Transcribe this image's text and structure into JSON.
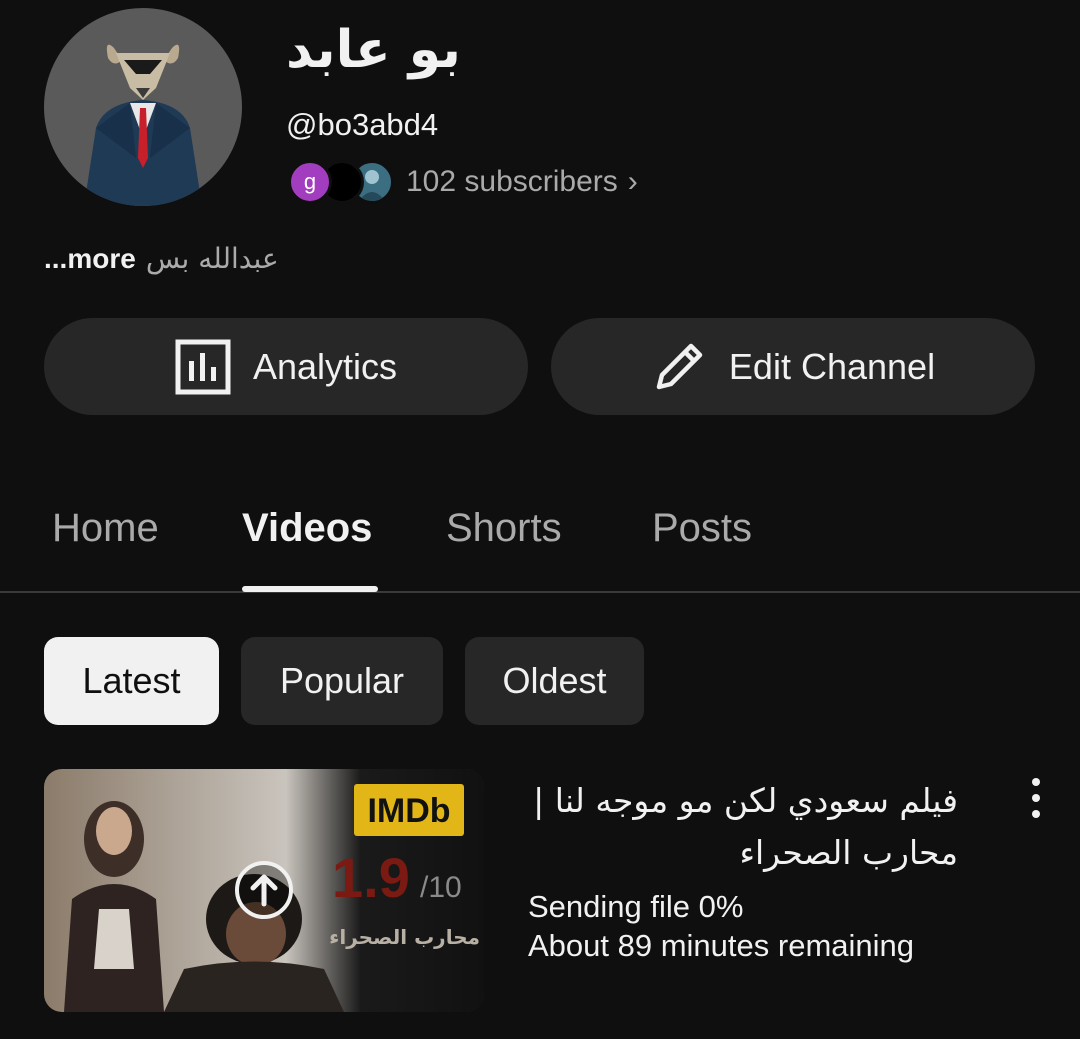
{
  "channel": {
    "name": "بو عابد",
    "handle": "@bo3abd4",
    "subscribers_text": "102 subscribers",
    "subscriber_avatar_initial": "g",
    "description": "عبدالله بس",
    "more_label": "...more"
  },
  "actions": {
    "analytics_label": "Analytics",
    "edit_label": "Edit Channel"
  },
  "tabs": [
    {
      "label": "Home",
      "active": false
    },
    {
      "label": "Videos",
      "active": true
    },
    {
      "label": "Shorts",
      "active": false
    },
    {
      "label": "Posts",
      "active": false
    }
  ],
  "sort_chips": [
    {
      "label": "Latest",
      "selected": true
    },
    {
      "label": "Popular",
      "selected": false
    },
    {
      "label": "Oldest",
      "selected": false
    }
  ],
  "video": {
    "title_line1": "فيلم سعودي لكن مو موجه لنا |",
    "title_line2": "محارب الصحراء",
    "status_line1": "Sending file 0%",
    "status_line2": "About 89 minutes remaining",
    "upload_progress_percent": 0,
    "thumb_badge": "IMDb",
    "thumb_rating": "1.9",
    "thumb_rating_scale": "/10",
    "thumb_caption": "محارب الصحراء"
  },
  "colors": {
    "background": "#0f0f0f",
    "button_bg": "#272727",
    "text_primary": "#f1f1f1",
    "text_secondary": "#aaaaaa",
    "imdb_yellow": "#e2b616"
  }
}
